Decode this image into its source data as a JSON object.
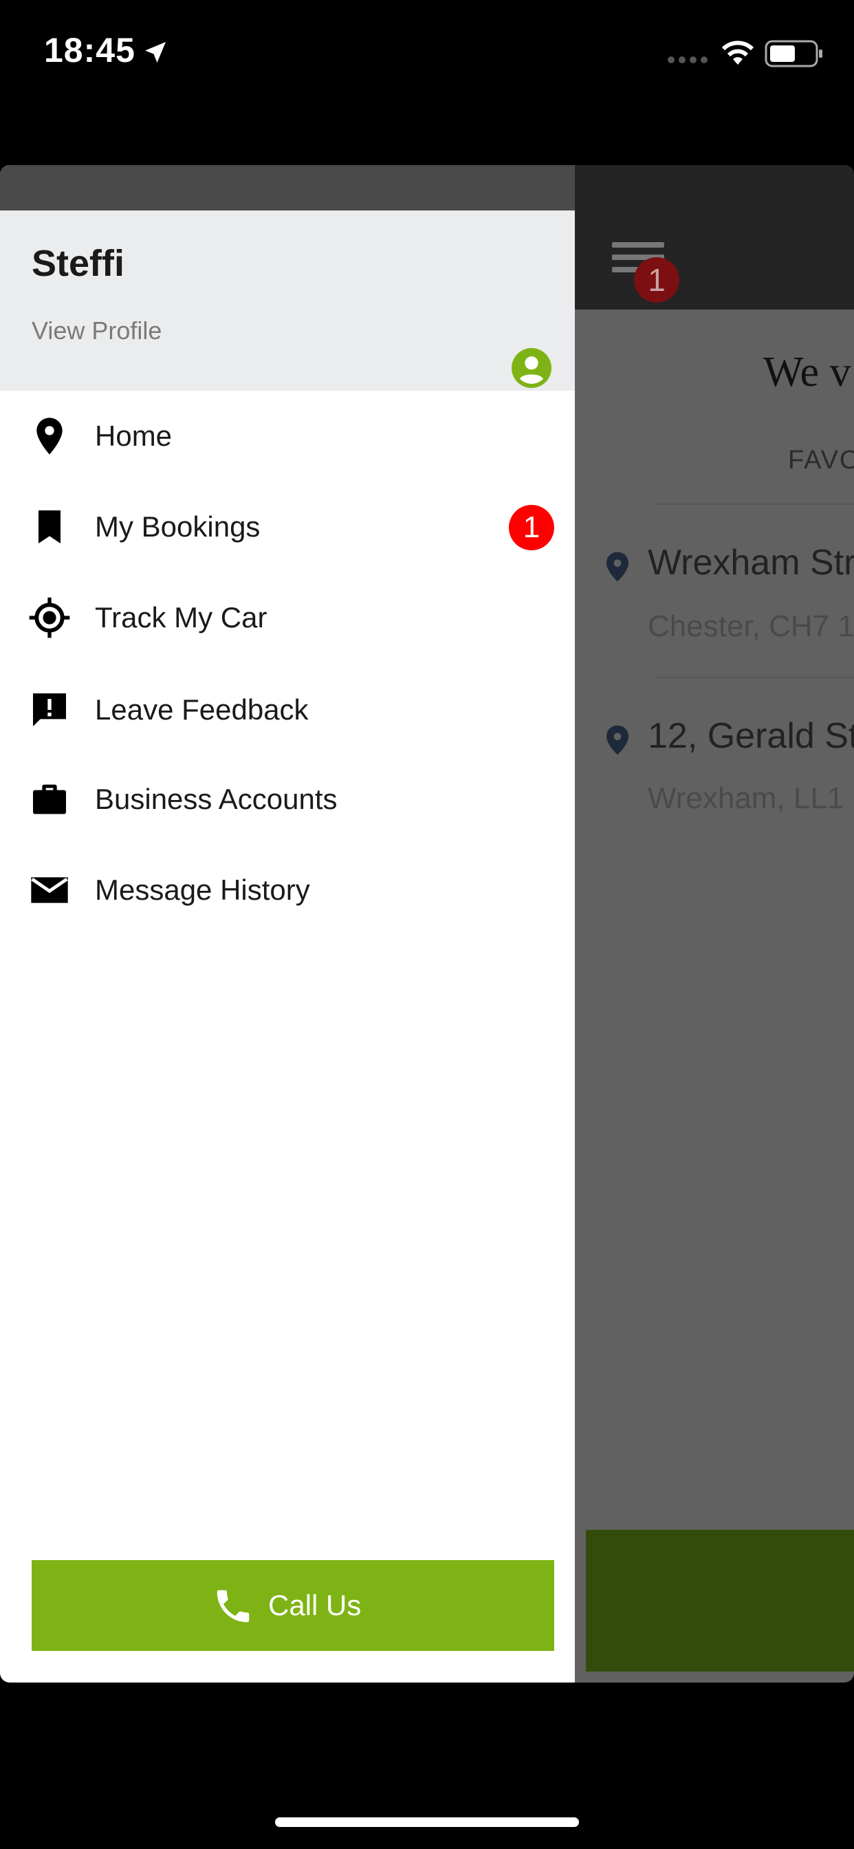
{
  "status_bar": {
    "time": "18:45"
  },
  "background_screen": {
    "notification_count": "1",
    "title": "We v",
    "tab": "FAVO",
    "favourites": [
      {
        "address": "Wrexham Str",
        "subtitle": "Chester, CH7 1"
      },
      {
        "address": "12, Gerald Str",
        "subtitle": "Wrexham, LL1"
      }
    ]
  },
  "drawer": {
    "profile": {
      "name": "Steffi",
      "view_profile": "View Profile"
    },
    "menu": [
      {
        "label": "Home",
        "icon": "location-pin-icon"
      },
      {
        "label": "My Bookings",
        "icon": "bookmark-icon",
        "badge": "1"
      },
      {
        "label": "Track My Car",
        "icon": "gps-target-icon"
      },
      {
        "label": "Leave Feedback",
        "icon": "feedback-icon"
      },
      {
        "label": "Business Accounts",
        "icon": "briefcase-icon"
      },
      {
        "label": "Message History",
        "icon": "envelope-icon"
      }
    ],
    "call_button": {
      "label": "Call Us",
      "icon": "phone-icon"
    }
  },
  "colors": {
    "accent_green": "#7eb315",
    "badge_red": "#ff0000",
    "profile_icon_green": "#7eb315",
    "drawer_header_bg": "#ebeced"
  }
}
